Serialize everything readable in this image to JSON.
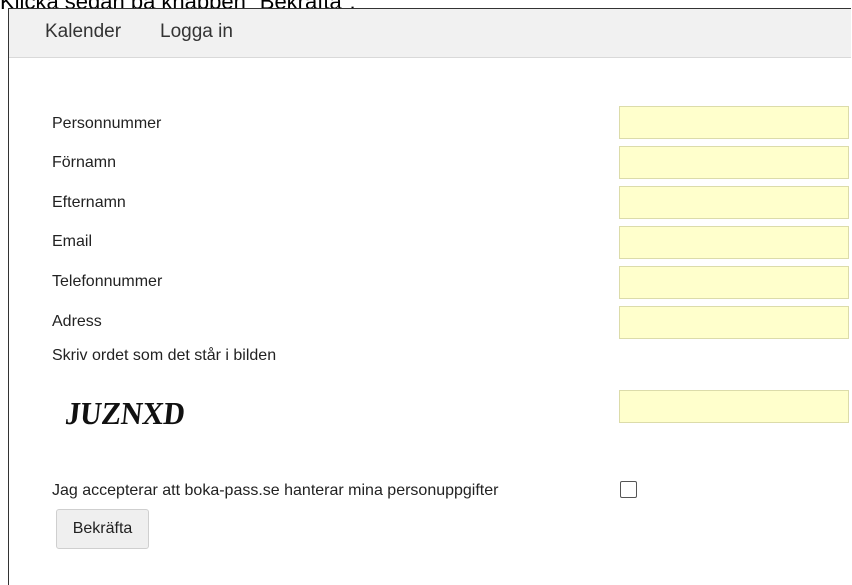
{
  "caption": "Klicka sedan på knappen \"Bekräfta\".",
  "nav": {
    "calendar": "Kalender",
    "login": "Logga in"
  },
  "form": {
    "fields": [
      {
        "label": "Personnummer",
        "value": ""
      },
      {
        "label": "Förnamn",
        "value": ""
      },
      {
        "label": "Efternamn",
        "value": ""
      },
      {
        "label": "Email",
        "value": ""
      },
      {
        "label": "Telefonnummer",
        "value": ""
      },
      {
        "label": "Adress",
        "value": ""
      }
    ],
    "captcha": {
      "instruction": "Skriv ordet som det står i bilden",
      "image_text": "JUZNXD",
      "value": ""
    },
    "consent_label": "Jag accepterar att boka-pass.se hanterar mina personuppgifter",
    "consent_checked": false,
    "confirm_label": "Bekräfta"
  },
  "colors": {
    "input_bg": "#ffffcc",
    "navbar_bg": "#f1f1f1"
  }
}
